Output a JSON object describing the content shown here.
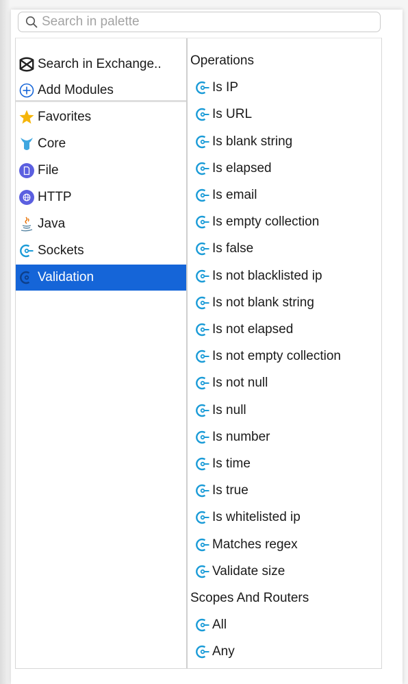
{
  "search": {
    "placeholder": "Search in palette"
  },
  "left_items": [
    {
      "label": "Search in Exchange..",
      "icon": "exchange-icon"
    },
    {
      "label": "Add Modules",
      "icon": "add-circle-icon"
    },
    {
      "label": "Favorites",
      "icon": "star-icon"
    },
    {
      "label": "Core",
      "icon": "core-mule-icon"
    },
    {
      "label": "File",
      "icon": "file-icon"
    },
    {
      "label": "HTTP",
      "icon": "http-globe-icon"
    },
    {
      "label": "Java",
      "icon": "java-icon"
    },
    {
      "label": "Sockets",
      "icon": "connector-icon"
    },
    {
      "label": "Validation",
      "icon": "connector-icon",
      "selected": true
    }
  ],
  "right": {
    "operations_header": "Operations",
    "operations": [
      "Is IP",
      "Is URL",
      "Is blank string",
      "Is elapsed",
      "Is email",
      "Is empty collection",
      "Is false",
      "Is not blacklisted ip",
      "Is not blank string",
      "Is not elapsed",
      "Is not empty collection",
      "Is not null",
      "Is null",
      "Is number",
      "Is time",
      "Is true",
      "Is whitelisted ip",
      "Matches regex",
      "Validate size"
    ],
    "scopes_header": "Scopes And Routers",
    "scopes": [
      "All",
      "Any"
    ]
  },
  "colors": {
    "selection": "#1565d8",
    "connector_icon": "#1a9bd7",
    "star": "#f5b50a",
    "file_http_icon": "#5b5fe0"
  }
}
